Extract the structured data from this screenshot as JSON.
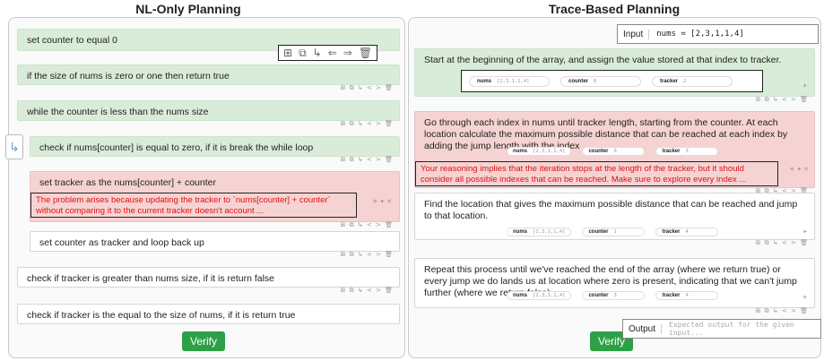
{
  "left": {
    "title": "NL-Only Planning",
    "steps": [
      "set counter to equal 0",
      "if the size of nums is zero or one then return true",
      "while the counter is less than the nums size",
      "check if nums[counter] is equal to zero, if it is break the while loop",
      "set tracker as the nums[counter] + counter",
      "set counter as tracker and loop back up",
      "check if tracker is greater than nums size, if it is return false",
      "check if tracker is the equal to the size of nums, if it is return true"
    ],
    "error": "The problem arises because updating the tracker to `nums[counter] + counter` without comparing it to the current tracker doesn't account ...",
    "verify_label": "Verify"
  },
  "right": {
    "title": "Trace-Based Planning",
    "input_label": "Input",
    "input_value": "nums = [2,3,1,1,4]",
    "steps": [
      "Start at the beginning of the array, and assign the value stored at that index to tracker.",
      "Go through each index in nums until tracker length, starting from the counter. At each location calculate the maximum possible distance that can be reached at each index by adding the jump length with the index",
      "Find the location that gives the maximum possible distance that can be reached and jump to that location.",
      "Repeat this process until we've reached the end of the array (where we return true) or every jump we do lands us at location where zero is present, indicating that we can't jump further (where we return false)."
    ],
    "error": "Your reasoning implies that the iteration stops at the length of the tracker, but it should consider all possible indexes that can be reached. Make sure to explore every index ...",
    "state_vars": [
      {
        "name": "nums",
        "value": "[2,3,1,1,4]"
      },
      {
        "name": "counter",
        "value": "0"
      },
      {
        "name": "tracker",
        "value": "2"
      }
    ],
    "state_vars_small": [
      {
        "name": "nums",
        "value": "[2,3,1,1,4]"
      },
      {
        "name": "counter",
        "value": "0"
      },
      {
        "name": "tracker",
        "value": "3"
      }
    ],
    "state_vars_3": [
      {
        "name": "nums",
        "value": "[2,3,1,1,4]"
      },
      {
        "name": "counter",
        "value": "1"
      },
      {
        "name": "tracker",
        "value": "4"
      }
    ],
    "state_vars_4": [
      {
        "name": "nums",
        "value": "[2,3,1,1,4]"
      },
      {
        "name": "counter",
        "value": "3"
      },
      {
        "name": "tracker",
        "value": "4"
      }
    ],
    "output_label": "Output",
    "output_placeholder": "Expected output for the given input...",
    "verify_label": "Verify"
  },
  "toolbar_icons": [
    "add-icon",
    "copy-icon",
    "indent-icon",
    "outdent-left-icon",
    "outdent-right-icon",
    "delete-icon"
  ],
  "toolbar_glyphs": "⊞ ⧉ ↳ ⇐ ⇒ 🗑",
  "mini_tools": "⊞ ⧉ ↳ < > 🗑",
  "plus": "+",
  "arrow": "↳"
}
